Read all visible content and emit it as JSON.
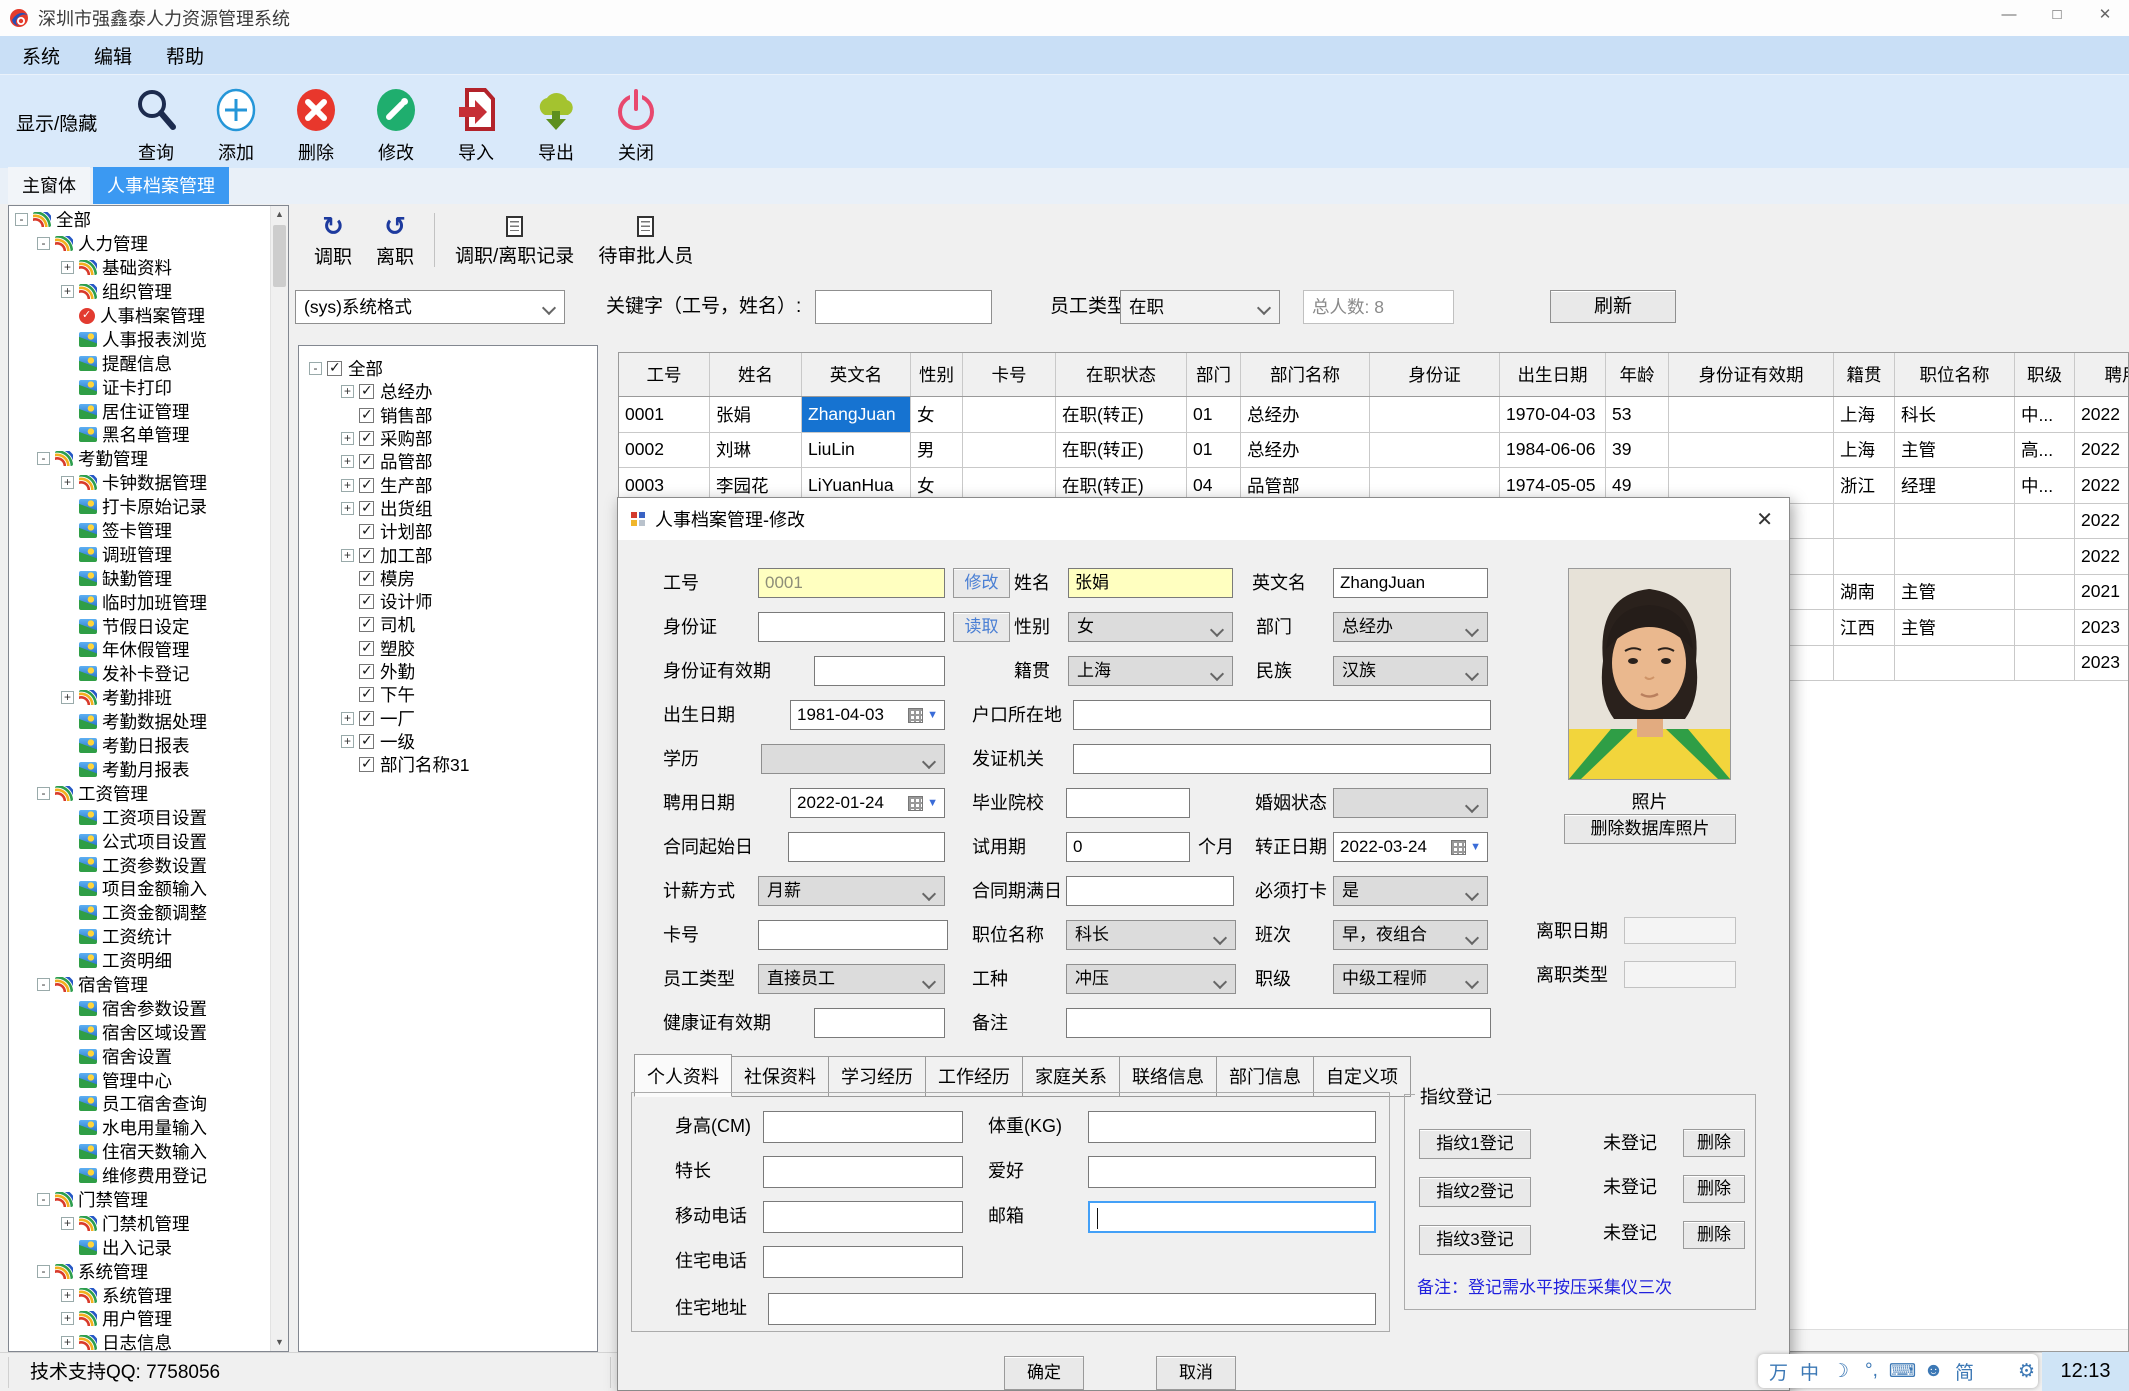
{
  "colors": {
    "accent_blue": "#3b99f2",
    "selection_blue": "#1673d1",
    "field_yellow": "#ffffc0",
    "toolbar_bg": "#d9e9fa",
    "note_blue": "#2121dd",
    "ime_red": "#e8432a"
  },
  "window": {
    "title": "深圳市强鑫泰人力资源管理系统",
    "minimize": "—",
    "maximize": "□",
    "close": "✕"
  },
  "menu": {
    "items": [
      {
        "label": "系统"
      },
      {
        "label": "编辑"
      },
      {
        "label": "帮助"
      }
    ]
  },
  "toolbar": {
    "toggle_label": "显示/隐藏",
    "buttons": [
      {
        "label": "查询"
      },
      {
        "label": "添加"
      },
      {
        "label": "删除"
      },
      {
        "label": "修改"
      },
      {
        "label": "导入"
      },
      {
        "label": "导出"
      },
      {
        "label": "关闭"
      }
    ]
  },
  "main_tabs": {
    "home": "主窗体",
    "active": "人事档案管理"
  },
  "nav_tree": {
    "items": [
      {
        "label": "全部",
        "level": 0,
        "exp": "minus",
        "icon": "branch"
      },
      {
        "label": "人力管理",
        "level": 1,
        "exp": "minus",
        "icon": "branch"
      },
      {
        "label": "基础资料",
        "level": 2,
        "exp": "plus",
        "icon": "branch"
      },
      {
        "label": "组织管理",
        "level": 2,
        "exp": "plus",
        "icon": "branch"
      },
      {
        "label": "人事档案管理",
        "level": 2,
        "exp": "none",
        "icon": "clock"
      },
      {
        "label": "人事报表浏览",
        "level": 2,
        "exp": "none",
        "icon": "leaf"
      },
      {
        "label": "提醒信息",
        "level": 2,
        "exp": "none",
        "icon": "leaf"
      },
      {
        "label": "证卡打印",
        "level": 2,
        "exp": "none",
        "icon": "leaf"
      },
      {
        "label": "居住证管理",
        "level": 2,
        "exp": "none",
        "icon": "leaf"
      },
      {
        "label": "黑名单管理",
        "level": 2,
        "exp": "none",
        "icon": "leaf"
      },
      {
        "label": "考勤管理",
        "level": 1,
        "exp": "minus",
        "icon": "branch"
      },
      {
        "label": "卡钟数据管理",
        "level": 2,
        "exp": "plus",
        "icon": "branch"
      },
      {
        "label": "打卡原始记录",
        "level": 2,
        "exp": "none",
        "icon": "leaf"
      },
      {
        "label": "签卡管理",
        "level": 2,
        "exp": "none",
        "icon": "leaf"
      },
      {
        "label": "调班管理",
        "level": 2,
        "exp": "none",
        "icon": "leaf"
      },
      {
        "label": "缺勤管理",
        "level": 2,
        "exp": "none",
        "icon": "leaf"
      },
      {
        "label": "临时加班管理",
        "level": 2,
        "exp": "none",
        "icon": "leaf"
      },
      {
        "label": "节假日设定",
        "level": 2,
        "exp": "none",
        "icon": "leaf"
      },
      {
        "label": "年休假管理",
        "level": 2,
        "exp": "none",
        "icon": "leaf"
      },
      {
        "label": "发补卡登记",
        "level": 2,
        "exp": "none",
        "icon": "leaf"
      },
      {
        "label": "考勤排班",
        "level": 2,
        "exp": "plus",
        "icon": "branch"
      },
      {
        "label": "考勤数据处理",
        "level": 2,
        "exp": "none",
        "icon": "leaf"
      },
      {
        "label": "考勤日报表",
        "level": 2,
        "exp": "none",
        "icon": "leaf"
      },
      {
        "label": "考勤月报表",
        "level": 2,
        "exp": "none",
        "icon": "leaf"
      },
      {
        "label": "工资管理",
        "level": 1,
        "exp": "minus",
        "icon": "branch"
      },
      {
        "label": "工资项目设置",
        "level": 2,
        "exp": "none",
        "icon": "leaf"
      },
      {
        "label": "公式项目设置",
        "level": 2,
        "exp": "none",
        "icon": "leaf"
      },
      {
        "label": "工资参数设置",
        "level": 2,
        "exp": "none",
        "icon": "leaf"
      },
      {
        "label": "项目金额输入",
        "level": 2,
        "exp": "none",
        "icon": "leaf"
      },
      {
        "label": "工资金额调整",
        "level": 2,
        "exp": "none",
        "icon": "leaf"
      },
      {
        "label": "工资统计",
        "level": 2,
        "exp": "none",
        "icon": "leaf"
      },
      {
        "label": "工资明细",
        "level": 2,
        "exp": "none",
        "icon": "leaf"
      },
      {
        "label": "宿舍管理",
        "level": 1,
        "exp": "minus",
        "icon": "branch"
      },
      {
        "label": "宿舍参数设置",
        "level": 2,
        "exp": "none",
        "icon": "leaf"
      },
      {
        "label": "宿舍区域设置",
        "level": 2,
        "exp": "none",
        "icon": "leaf"
      },
      {
        "label": "宿舍设置",
        "level": 2,
        "exp": "none",
        "icon": "leaf"
      },
      {
        "label": "管理中心",
        "level": 2,
        "exp": "none",
        "icon": "leaf"
      },
      {
        "label": "员工宿舍查询",
        "level": 2,
        "exp": "none",
        "icon": "leaf"
      },
      {
        "label": "水电用量输入",
        "level": 2,
        "exp": "none",
        "icon": "leaf"
      },
      {
        "label": "住宿天数输入",
        "level": 2,
        "exp": "none",
        "icon": "leaf"
      },
      {
        "label": "维修费用登记",
        "level": 2,
        "exp": "none",
        "icon": "leaf"
      },
      {
        "label": "门禁管理",
        "level": 1,
        "exp": "minus",
        "icon": "branch"
      },
      {
        "label": "门禁机管理",
        "level": 2,
        "exp": "plus",
        "icon": "branch"
      },
      {
        "label": "出入记录",
        "level": 2,
        "exp": "none",
        "icon": "leaf"
      },
      {
        "label": "系统管理",
        "level": 1,
        "exp": "minus",
        "icon": "branch"
      },
      {
        "label": "系统管理",
        "level": 2,
        "exp": "plus",
        "icon": "branch"
      },
      {
        "label": "用户管理",
        "level": 2,
        "exp": "plus",
        "icon": "branch"
      },
      {
        "label": "日志信息",
        "level": 2,
        "exp": "plus",
        "icon": "branch"
      }
    ]
  },
  "actions": {
    "buttons": [
      {
        "label": "调职",
        "glyph": "↻"
      },
      {
        "label": "离职",
        "glyph": "↺"
      },
      {
        "label": "调职/离职记录"
      },
      {
        "label": "待审批人员"
      }
    ]
  },
  "filter": {
    "format_value": "(sys)系统格式",
    "keyword_label": "关键字（工号，姓名）:",
    "keyword_value": "",
    "type_label": "员工类型",
    "type_value": "在职",
    "total_text": "总人数: 8",
    "refresh_label": "刷新"
  },
  "dept_tree": {
    "items": [
      {
        "label": "全部",
        "level": 0,
        "exp": "minus",
        "checked": "1"
      },
      {
        "label": "总经办",
        "level": 1,
        "exp": "plus",
        "checked": "1"
      },
      {
        "label": "销售部",
        "level": 1,
        "exp": "none",
        "checked": "1"
      },
      {
        "label": "采购部",
        "level": 1,
        "exp": "plus",
        "checked": "1"
      },
      {
        "label": "品管部",
        "level": 1,
        "exp": "plus",
        "checked": "1"
      },
      {
        "label": "生产部",
        "level": 1,
        "exp": "plus",
        "checked": "1"
      },
      {
        "label": "出货组",
        "level": 1,
        "exp": "plus",
        "checked": "1"
      },
      {
        "label": "计划部",
        "level": 1,
        "exp": "none",
        "checked": "1"
      },
      {
        "label": "加工部",
        "level": 1,
        "exp": "plus",
        "checked": "1"
      },
      {
        "label": "模房",
        "level": 1,
        "exp": "none",
        "checked": "1"
      },
      {
        "label": "设计师",
        "level": 1,
        "exp": "none",
        "checked": "1"
      },
      {
        "label": "司机",
        "level": 1,
        "exp": "none",
        "checked": "1"
      },
      {
        "label": "塑胶",
        "level": 1,
        "exp": "none",
        "checked": "1"
      },
      {
        "label": "外勤",
        "level": 1,
        "exp": "none",
        "checked": "1"
      },
      {
        "label": "下午",
        "level": 1,
        "exp": "none",
        "checked": "1"
      },
      {
        "label": "一厂",
        "level": 1,
        "exp": "plus",
        "checked": "1"
      },
      {
        "label": "一级",
        "level": 1,
        "exp": "plus",
        "checked": "1"
      },
      {
        "label": "部门名称31",
        "level": 1,
        "exp": "none",
        "checked": "1"
      }
    ]
  },
  "table": {
    "columns": [
      "工号",
      "姓名",
      "英文名",
      "性别",
      "卡号",
      "在职状态",
      "部门",
      "部门名称",
      "身份证",
      "出生日期",
      "年龄",
      "身份证有效期",
      "籍贯",
      "职位名称",
      "职级",
      "聘用日期"
    ],
    "rows": [
      {
        "c0": "0001",
        "c1": "张娟",
        "c2": "ZhangJuan",
        "sel": "1",
        "c3": "女",
        "c4": "",
        "c5": "在职(转正)",
        "c6": "01",
        "c7": "总经办",
        "c8": "",
        "c9": "1970-04-03",
        "c10": "53",
        "c11": "",
        "c12": "上海",
        "c13": "科长",
        "c14": "中...",
        "c15": "2022"
      },
      {
        "c0": "0002",
        "c1": "刘琳",
        "c2": "LiuLin",
        "c3": "男",
        "c4": "",
        "c5": "在职(转正)",
        "c6": "01",
        "c7": "总经办",
        "c8": "",
        "c9": "1984-06-06",
        "c10": "39",
        "c11": "",
        "c12": "上海",
        "c13": "主管",
        "c14": "高...",
        "c15": "2022"
      },
      {
        "c0": "0003",
        "c1": "李园花",
        "c2": "LiYuanHua",
        "c3": "女",
        "c4": "",
        "c5": "在职(转正)",
        "c6": "04",
        "c7": "品管部",
        "c8": "",
        "c9": "1974-05-05",
        "c10": "49",
        "c11": "",
        "c12": "浙江",
        "c13": "经理",
        "c14": "中...",
        "c15": "2022"
      },
      {
        "c0": "",
        "c1": "",
        "c2": "",
        "c3": "",
        "c4": "",
        "c5": "",
        "c6": "",
        "c7": "",
        "c8": "",
        "c9": "",
        "c10": "",
        "c11": "",
        "c12": "",
        "c13": "",
        "c14": "",
        "c15": "2022"
      },
      {
        "c0": "",
        "c1": "",
        "c2": "",
        "c3": "",
        "c4": "",
        "c5": "",
        "c6": "",
        "c7": "",
        "c8": "",
        "c9": "",
        "c10": "",
        "c11": "",
        "c12": "",
        "c13": "",
        "c14": "",
        "c15": "2022"
      },
      {
        "c0": "",
        "c1": "",
        "c2": "",
        "c3": "",
        "c4": "",
        "c5": "",
        "c6": "",
        "c7": "",
        "c8": "",
        "c9": "",
        "c10": "",
        "c11": "",
        "c12": "湖南",
        "c13": "主管",
        "c14": "",
        "c15": "2021"
      },
      {
        "c0": "",
        "c1": "",
        "c2": "",
        "c3": "",
        "c4": "",
        "c5": "",
        "c6": "",
        "c7": "",
        "c8": "",
        "c9": "",
        "c10": "",
        "c11": "",
        "c12": "江西",
        "c13": "主管",
        "c14": "",
        "c15": "2023"
      },
      {
        "c0": "",
        "c1": "",
        "c2": "",
        "c3": "",
        "c4": "",
        "c5": "",
        "c6": "",
        "c7": "",
        "c8": "",
        "c9": "",
        "c10": "",
        "c11": "",
        "c12": "",
        "c13": "",
        "c14": "",
        "c15": "2023"
      }
    ]
  },
  "dialog": {
    "title": "人事档案管理-修改",
    "close": "✕",
    "f": {
      "emp_no": {
        "label": "工号",
        "value": "0001"
      },
      "modify_btn": "修改",
      "name": {
        "label": "姓名",
        "value": "张娟"
      },
      "en_name": {
        "label": "英文名",
        "value": "ZhangJuan"
      },
      "id_card": {
        "label": "身份证",
        "value": ""
      },
      "read_btn": "读取",
      "gender": {
        "label": "性别",
        "value": "女"
      },
      "dept": {
        "label": "部门",
        "value": "总经办"
      },
      "id_valid": {
        "label": "身份证有效期",
        "value": ""
      },
      "native": {
        "label": "籍贯",
        "value": "上海"
      },
      "ethnic": {
        "label": "民族",
        "value": "汉族"
      },
      "birth": {
        "label": "出生日期",
        "value": "1981-04-03"
      },
      "household": {
        "label": "户口所在地",
        "value": ""
      },
      "education": {
        "label": "学历",
        "value": ""
      },
      "issuer": {
        "label": "发证机关",
        "value": ""
      },
      "hire_date": {
        "label": "聘用日期",
        "value": "2022-01-24"
      },
      "school": {
        "label": "毕业院校",
        "value": ""
      },
      "marital": {
        "label": "婚姻状态",
        "value": ""
      },
      "contract_start": {
        "label": "合同起始日",
        "value": ""
      },
      "probation": {
        "label": "试用期",
        "value": "0",
        "unit": "个月"
      },
      "regular_date": {
        "label": "转正日期",
        "value": "2022-03-24"
      },
      "pay_mode": {
        "label": "计薪方式",
        "value": "月薪"
      },
      "contract_end": {
        "label": "合同期满日",
        "value": ""
      },
      "must_punch": {
        "label": "必须打卡",
        "value": "是"
      },
      "card_no": {
        "label": "卡号",
        "value": ""
      },
      "position": {
        "label": "职位名称",
        "value": "科长"
      },
      "shift": {
        "label": "班次",
        "value": "早，夜组合"
      },
      "emp_type": {
        "label": "员工类型",
        "value": "直接员工"
      },
      "work_type": {
        "label": "工种",
        "value": "冲压"
      },
      "rank": {
        "label": "职级",
        "value": "中级工程师"
      },
      "health_valid": {
        "label": "健康证有效期",
        "value": ""
      },
      "remark": {
        "label": "备注",
        "value": ""
      },
      "leave_date": {
        "label": "离职日期",
        "value": ""
      },
      "leave_type": {
        "label": "离职类型",
        "value": ""
      },
      "photo_label": "照片",
      "delete_photo": "删除数据库照片"
    },
    "tabs": [
      {
        "label": "个人资料",
        "active": "1"
      },
      {
        "label": "社保资料"
      },
      {
        "label": "学习经历"
      },
      {
        "label": "工作经历"
      },
      {
        "label": "家庭关系"
      },
      {
        "label": "联络信息"
      },
      {
        "label": "部门信息"
      },
      {
        "label": "自定义项"
      }
    ],
    "personal": {
      "height": "身高(CM)",
      "weight": "体重(KG)",
      "specialty": "特长",
      "hobby": "爱好",
      "mobile": "移动电话",
      "email": "邮箱",
      "home_phone": "住宅电话",
      "home_address": "住宅地址"
    },
    "fingerprint": {
      "legend": "指纹登记",
      "rows": [
        {
          "btn": "指纹1登记",
          "status": "未登记",
          "del": "删除"
        },
        {
          "btn": "指纹2登记",
          "status": "未登记",
          "del": "删除"
        },
        {
          "btn": "指纹3登记",
          "status": "未登记",
          "del": "删除"
        }
      ],
      "note": "备注：登记需水平按压采集仪三次"
    },
    "footer": {
      "ok": "确定",
      "cancel": "取消"
    }
  },
  "statusbar": {
    "support": "技术支持QQ: 7758056",
    "time": "12:13",
    "ime": [
      {
        "name": "wan-ime-icon",
        "glyph": "万"
      },
      {
        "name": "chinese-mode-icon",
        "glyph": "中"
      },
      {
        "name": "moon-icon",
        "glyph": "☽"
      },
      {
        "name": "punctuation-icon",
        "glyph": "°,"
      },
      {
        "name": "keyboard-icon",
        "glyph": "⌨"
      },
      {
        "name": "user-icon",
        "glyph": "☻"
      },
      {
        "name": "simplified-icon",
        "glyph": "简"
      },
      {
        "name": "shirt-icon",
        "glyph": ""
      },
      {
        "name": "gear-icon",
        "glyph": "⚙"
      }
    ]
  }
}
